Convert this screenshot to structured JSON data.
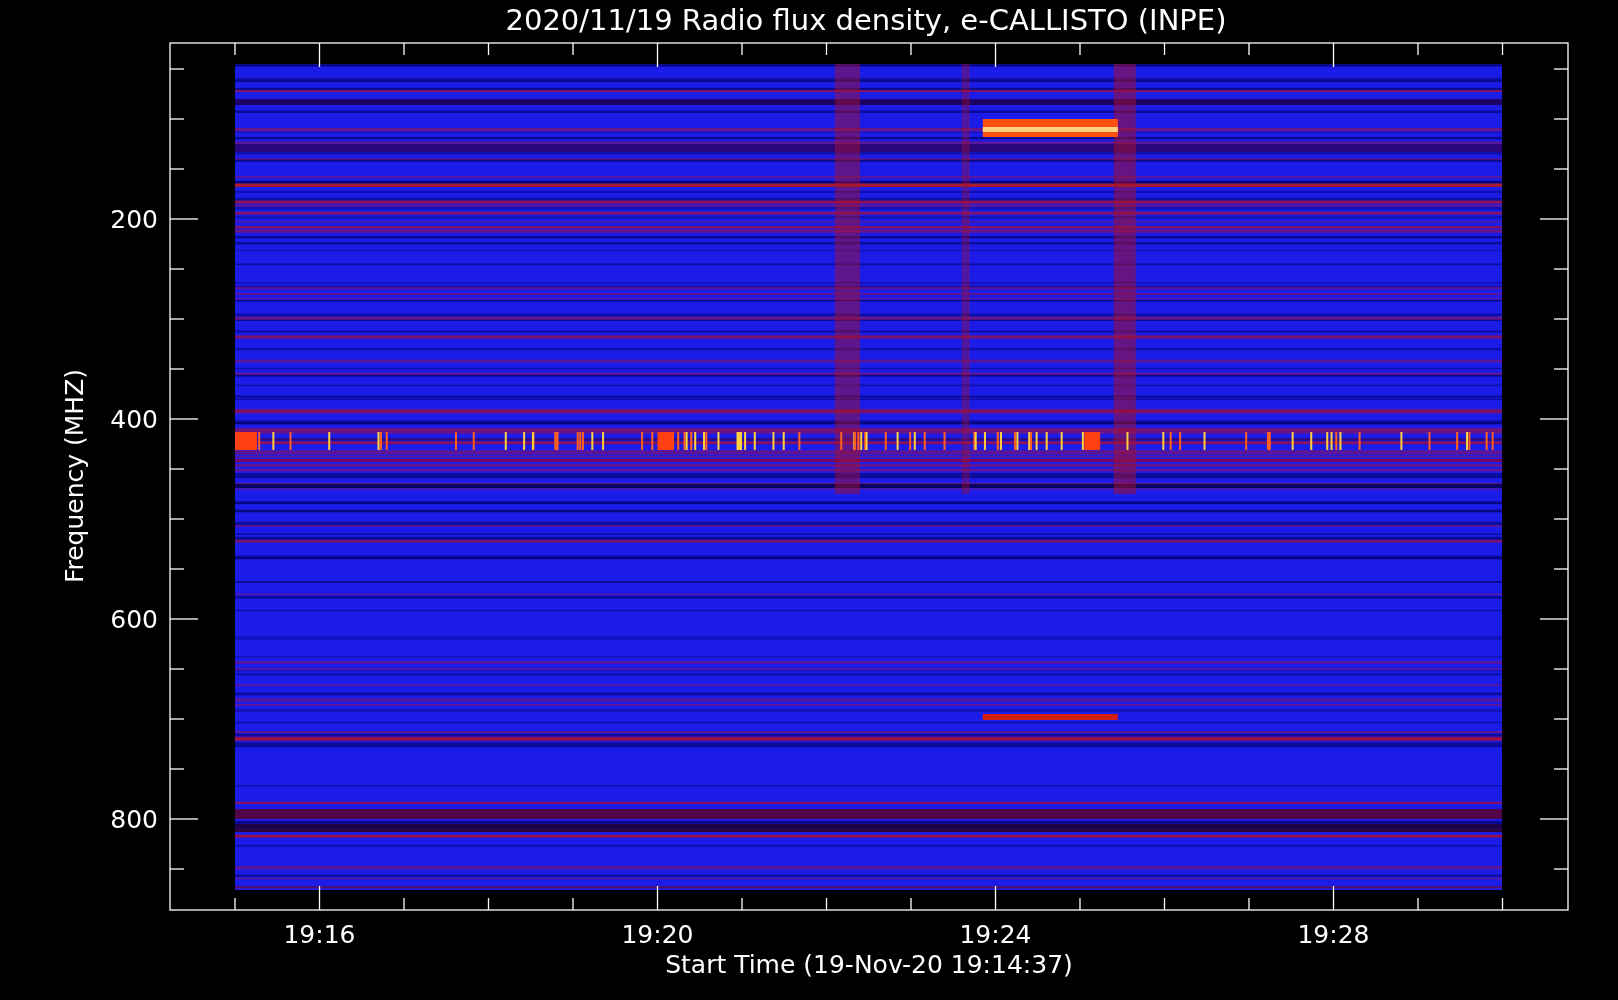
{
  "title": "2020/11/19  Radio flux density, e-CALLISTO (INPE)",
  "y_axis": {
    "label": "Frequency (MHZ)",
    "ticks": [
      "200",
      "400",
      "600",
      "800"
    ]
  },
  "x_axis": {
    "label": "Start Time (19-Nov-20 19:14:37)",
    "ticks": [
      "19:16",
      "19:20",
      "19:24",
      "19:28"
    ]
  }
}
